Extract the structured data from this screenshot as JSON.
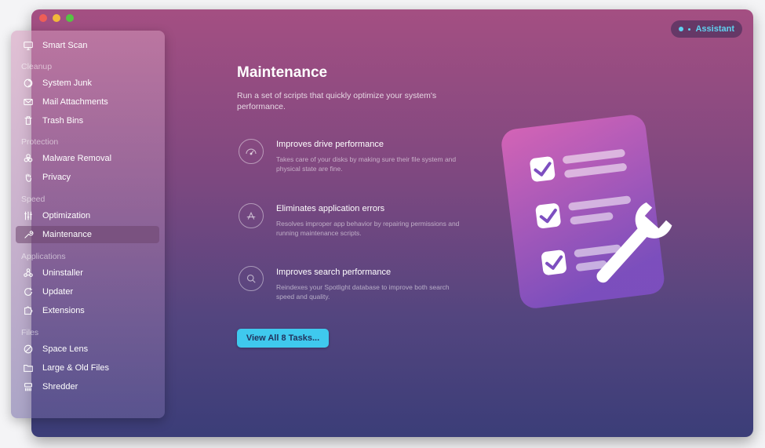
{
  "sidebar": {
    "smart_scan": "Smart Scan",
    "sections": {
      "cleanup": "Cleanup",
      "protection": "Protection",
      "speed": "Speed",
      "applications": "Applications",
      "files": "Files"
    },
    "items": {
      "system_junk": "System Junk",
      "mail_attachments": "Mail Attachments",
      "trash_bins": "Trash Bins",
      "malware_removal": "Malware Removal",
      "privacy": "Privacy",
      "optimization": "Optimization",
      "maintenance": "Maintenance",
      "uninstaller": "Uninstaller",
      "updater": "Updater",
      "extensions": "Extensions",
      "space_lens": "Space Lens",
      "large_old_files": "Large & Old Files",
      "shredder": "Shredder"
    },
    "active_item": "Maintenance"
  },
  "assistant": {
    "label": "Assistant"
  },
  "main": {
    "title": "Maintenance",
    "description": "Run a set of scripts that quickly optimize your system's performance.",
    "features": [
      {
        "icon": "gauge-icon",
        "title": "Improves drive performance",
        "description": "Takes care of your disks by making sure their file system and physical state are fine."
      },
      {
        "icon": "app-store-icon",
        "title": "Eliminates application errors",
        "description": "Resolves improper app behavior by repairing permissions and running maintenance scripts."
      },
      {
        "icon": "magnifier-icon",
        "title": "Improves search performance",
        "description": "Reindexes your Spotlight database to improve both search speed and quality."
      }
    ],
    "view_button": "View All 8 Tasks..."
  },
  "colors": {
    "accent": "#3fc9ee",
    "window_top": "#a44f82",
    "window_bottom": "#3b3d78"
  }
}
